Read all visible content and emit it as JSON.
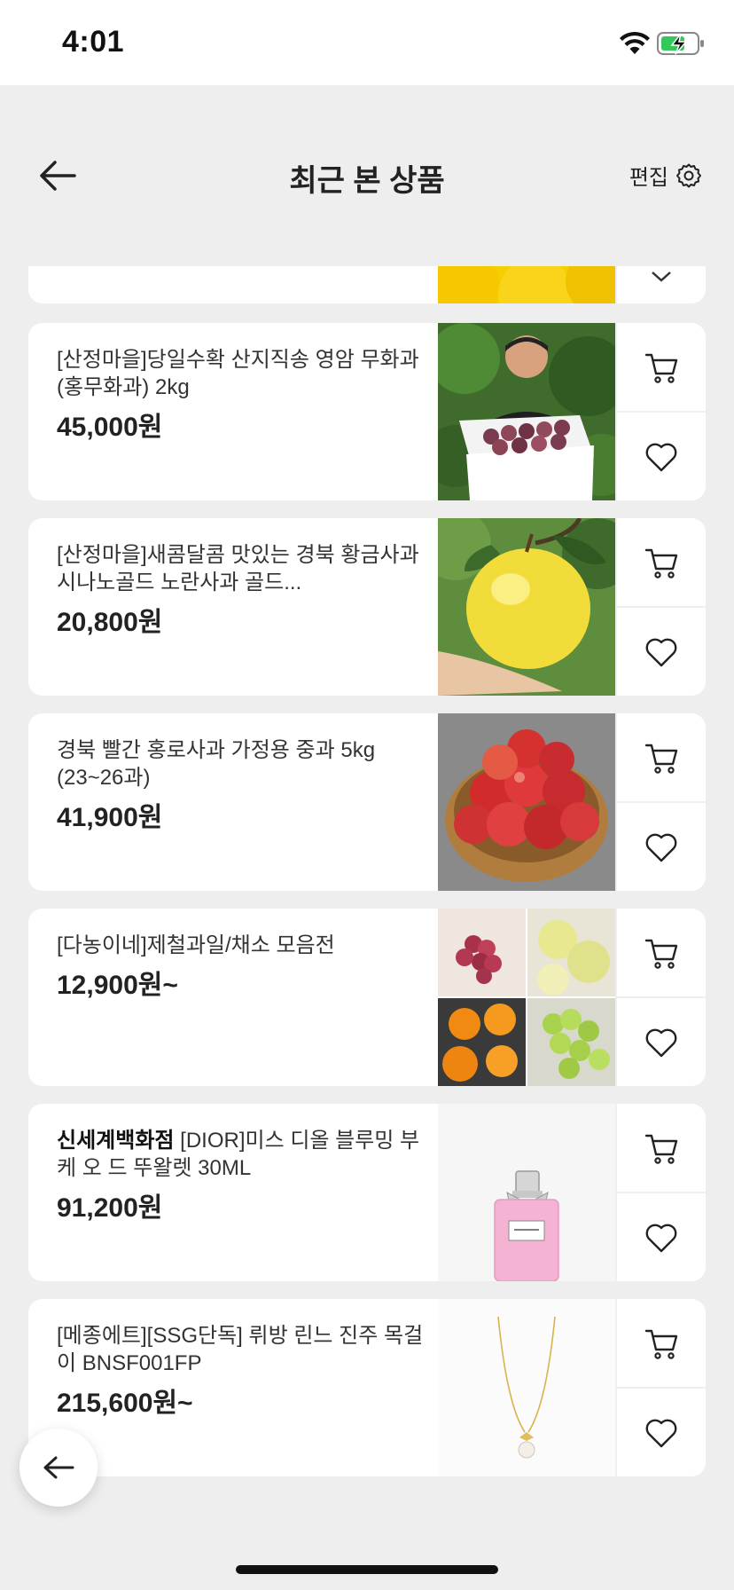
{
  "status_bar": {
    "time": "4:01"
  },
  "header": {
    "title": "최근 본 상품",
    "edit_label": "편집"
  },
  "items": [
    {
      "brand": "",
      "name": "[산정마을]당일수확 산지직송 영암 무화과 (홍무화과) 2kg",
      "price": "45,000원"
    },
    {
      "brand": "",
      "name": "[산정마을]새콤달콤 맛있는 경북 황금사과 시나노골드 노란사과 골드...",
      "price": "20,800원"
    },
    {
      "brand": "",
      "name": "경북  빨간 홍로사과 가정용 중과 5kg (23~26과)",
      "price": "41,900원"
    },
    {
      "brand": "",
      "name": "[다농이네]제철과일/채소 모음전",
      "price": "12,900원~"
    },
    {
      "brand": "신세계백화점",
      "name": " [DIOR]미스 디올 블루밍 부케 오 드 뚜왈렛 30ML",
      "price": "91,200원"
    },
    {
      "brand": "",
      "name": "[메종에트][SSG단독] 뤼방 린느 진주 목걸이 BNSF001FP",
      "price": "215,600원~"
    }
  ]
}
